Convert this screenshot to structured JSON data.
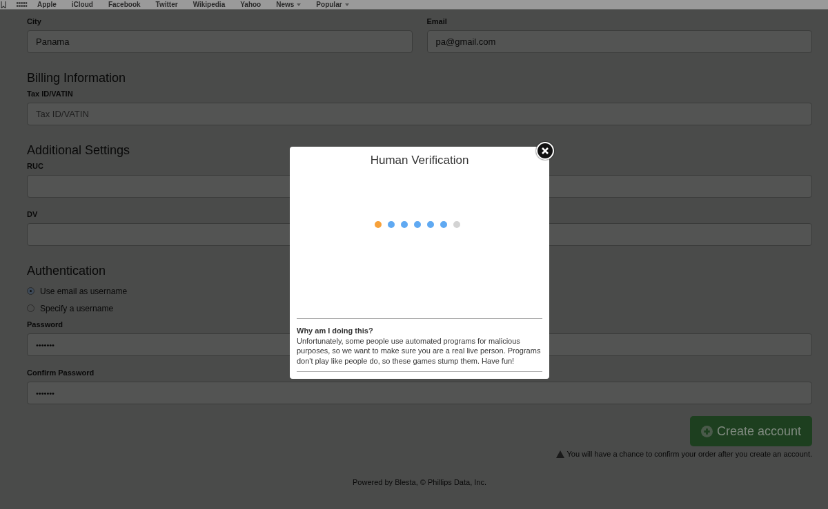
{
  "bookmarks_bar": {
    "items": [
      {
        "label": "Apple",
        "has_menu": false
      },
      {
        "label": "iCloud",
        "has_menu": false
      },
      {
        "label": "Facebook",
        "has_menu": false
      },
      {
        "label": "Twitter",
        "has_menu": false
      },
      {
        "label": "Wikipedia",
        "has_menu": false
      },
      {
        "label": "Yahoo",
        "has_menu": false
      },
      {
        "label": "News",
        "has_menu": true
      },
      {
        "label": "Popular",
        "has_menu": true
      }
    ]
  },
  "contact": {
    "city": {
      "label": "City",
      "value": "Panama"
    },
    "email": {
      "label": "Email",
      "value": "pa@gmail.com"
    }
  },
  "sections": [
    {
      "heading": "Billing Information",
      "fields": [
        {
          "label": "Tax ID/VATIN",
          "placeholder": "Tax ID/VATIN"
        }
      ]
    },
    {
      "heading": "Additional Settings",
      "fields": [
        {
          "label": "RUC"
        },
        {
          "label": "DV"
        }
      ]
    }
  ],
  "authentication": {
    "heading": "Authentication",
    "options": [
      {
        "label": "Use email as username",
        "selected": true
      },
      {
        "label": "Specify a username",
        "selected": false
      }
    ],
    "fields": [
      {
        "label": "Password",
        "value": "•••••••"
      },
      {
        "label": "Confirm Password",
        "value": "•••••••"
      }
    ]
  },
  "create_button": "Create account",
  "notice": "You will have a chance to confirm your order after you create an account.",
  "footer": "Powered by Blesta, © Phillips Data, Inc.",
  "modal": {
    "title": "Human Verification",
    "dots": [
      {
        "color": "#f7a13a"
      },
      {
        "color": "#5fa9f2"
      },
      {
        "color": "#5fa9f2"
      },
      {
        "color": "#5fa9f2"
      },
      {
        "color": "#5fa9f2"
      },
      {
        "color": "#5fa9f2"
      },
      {
        "color": "#d3d3d3"
      }
    ],
    "info_heading": "Why am I doing this?",
    "info_text": "Unfortunately, some people use automated programs for malicious purposes, so we want to make sure you are a real live person. Programs don't play like people do, so these games stump them. Have fun!"
  }
}
